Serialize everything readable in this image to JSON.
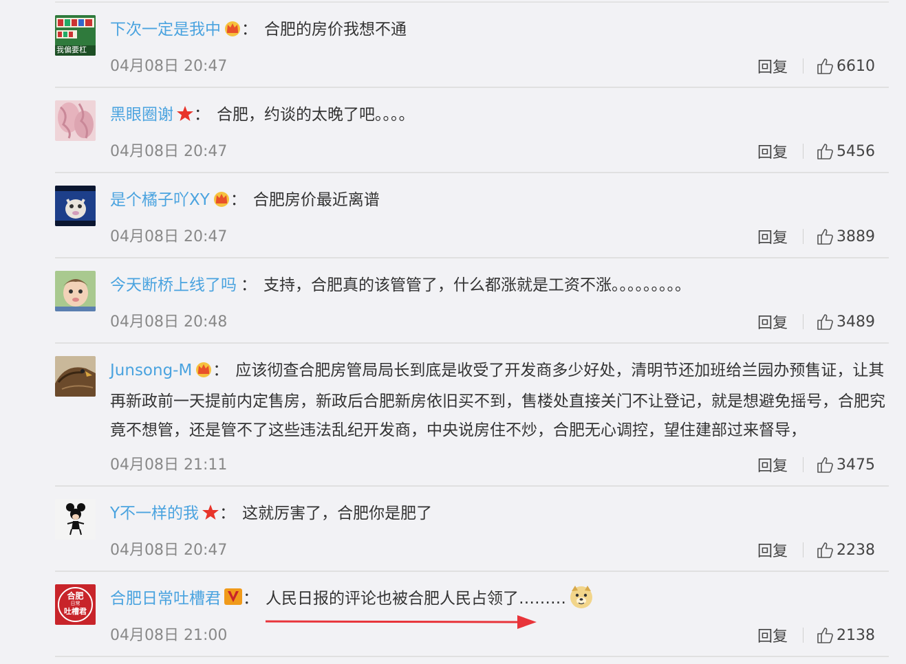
{
  "comments": [
    {
      "user": "下次一定是我中",
      "badge": "crown",
      "colon": "：",
      "text": "合肥的房价我想不通",
      "time": "04月08日 20:47",
      "reply": "回复",
      "likes": "6610",
      "avatar_icon": "mahjong-avatar-icon",
      "avatar_text": "我偏要杠"
    },
    {
      "user": "黑眼圈谢",
      "badge": "star",
      "colon": "：",
      "text": "合肥，约谈的太晚了吧。。。。",
      "time": "04月08日 20:47",
      "reply": "回复",
      "likes": "5456",
      "avatar_icon": "pink-fabric-avatar-icon"
    },
    {
      "user": "是个橘子吖XY",
      "badge": "crown",
      "colon": "：",
      "text": "合肥房价最近离谱",
      "time": "04月08日 20:47",
      "reply": "回复",
      "likes": "3889",
      "avatar_icon": "alpaca-avatar-icon"
    },
    {
      "user": "今天断桥上线了吗",
      "badge": "",
      "colon": "：",
      "text": "支持，合肥真的该管管了，什么都涨就是工资不涨。。。。。。。。。",
      "time": "04月08日 20:48",
      "reply": "回复",
      "likes": "3489",
      "avatar_icon": "baby-avatar-icon"
    },
    {
      "user": "Junsong-M",
      "badge": "crown",
      "colon": "：",
      "text": "应该彻查合肥房管局局长到底是收受了开发商多少好处，清明节还加班给兰园办预售证，让其再新政前一天提前内定售房，新政后合肥新房依旧买不到，售楼处直接关门不让登记，就是想避免摇号，合肥究竟不想管，还是管不了这些违法乱纪开发商，中央说房住不炒，合肥无心调控，望住建部过来督导，",
      "time": "04月08日 21:11",
      "reply": "回复",
      "likes": "3475",
      "avatar_icon": "eagle-avatar-icon"
    },
    {
      "user": "Y不一样的我",
      "badge": "star",
      "colon": "：",
      "text": "这就厉害了，合肥你是肥了",
      "time": "04月08日 20:47",
      "reply": "回复",
      "likes": "2238",
      "avatar_icon": "mickey-avatar-icon"
    },
    {
      "user": "合肥日常吐槽君",
      "badge": "verified-v",
      "colon": "：",
      "text": "人民日报的评论也被合肥人民占领了………",
      "time": "04月08日 21:00",
      "reply": "回复",
      "likes": "2138",
      "avatar_icon": "hefei-logo-avatar-icon",
      "avatar_text": [
        "合肥",
        "日常",
        "吐槽君"
      ],
      "emoji": "doge-emoji-icon"
    }
  ],
  "colors": {
    "username": "#4aa3df",
    "text": "#333333",
    "meta": "#888888",
    "annotation_arrow": "#e8343a"
  }
}
